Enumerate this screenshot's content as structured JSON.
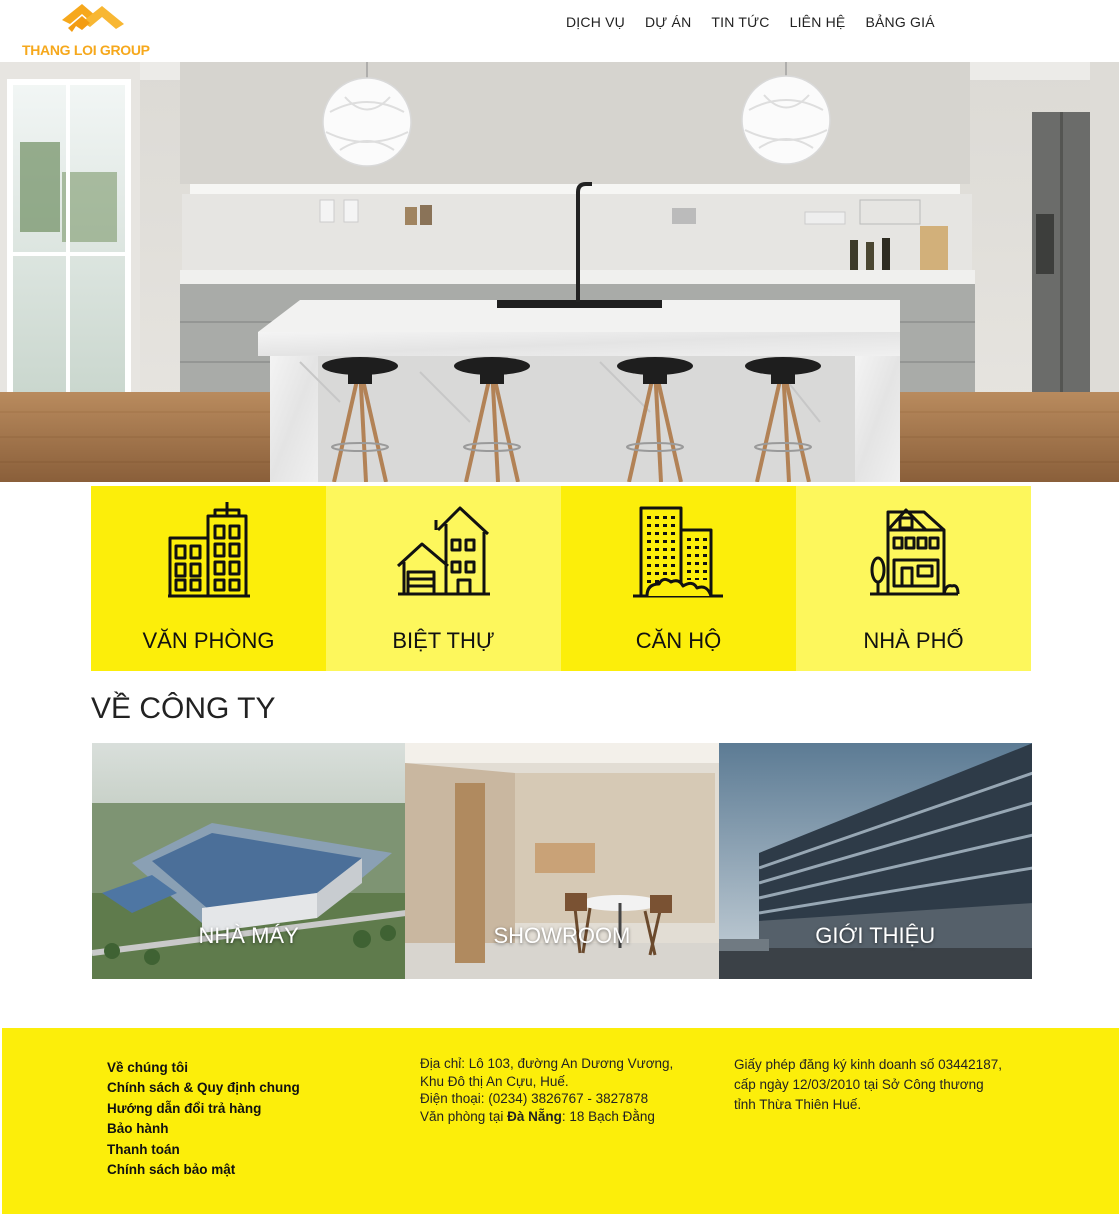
{
  "logo": {
    "text": "THANG LOI GROUP"
  },
  "nav": {
    "items": [
      {
        "label": "DỊCH VỤ"
      },
      {
        "label": "DỰ ÁN"
      },
      {
        "label": "TIN TỨC"
      },
      {
        "label": "LIÊN HỆ"
      },
      {
        "label": "BẢNG GIÁ"
      }
    ]
  },
  "categories": [
    {
      "label": "VĂN PHÒNG",
      "icon": "office-building-icon"
    },
    {
      "label": "BIỆT THỰ",
      "icon": "villa-icon"
    },
    {
      "label": "CĂN HỘ",
      "icon": "apartment-icon"
    },
    {
      "label": "NHÀ PHỐ",
      "icon": "townhouse-icon"
    }
  ],
  "about": {
    "title": "VỀ CÔNG TY",
    "tiles": [
      {
        "label": "NHÀ MÁY"
      },
      {
        "label": "SHOWROOM"
      },
      {
        "label": "GIỚI THIỆU"
      }
    ]
  },
  "footer": {
    "links": [
      "Về chúng tôi",
      "Chính sách & Quy định chung",
      "Hướng dẫn đổi trả hàng",
      "Bảo hành",
      "Thanh toán",
      "Chính sách bảo mật"
    ],
    "address_line1": "Địa chỉ: Lô 103, đường An Dương Vương,",
    "address_line2": "Khu Đô thị An Cựu, Huế.",
    "phone": "Điện thoại: (0234) 3826767 - 3827878",
    "office_prefix": "Văn phòng tại ",
    "office_city": "Đà Nẵng",
    "office_suffix": ": 18 Bạch Đằng",
    "license_line1": "Giấy phép đăng ký kinh doanh số 03442187,",
    "license_line2": "cấp ngày 12/03/2010 tại Sở Công thương",
    "license_line3": "tỉnh Thừa Thiên Huế."
  },
  "colors": {
    "yellow": "#fcee0a",
    "light_yellow": "#fdf75c",
    "logo_orange": "#f6a81c"
  }
}
